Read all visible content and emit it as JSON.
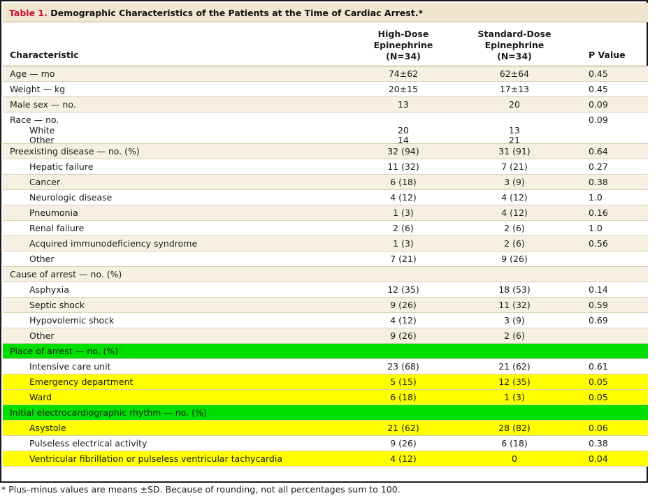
{
  "table": {
    "title_label": "Table 1.",
    "title_text": "Demographic Characteristics of the Patients at the Time of Cardiac Arrest.*",
    "columns": {
      "characteristic": "Characteristic",
      "high_line1": "High-Dose",
      "high_line2": "Epinephrine",
      "high_line3": "(N=34)",
      "std_line1": "Standard-Dose",
      "std_line2": "Epinephrine",
      "std_line3": "(N=34)",
      "p_value": "P Value"
    },
    "rows": [
      {
        "label": "Age — mo",
        "high": "74±62",
        "std": "62±64",
        "p": "0.45"
      },
      {
        "label": "Weight — kg",
        "high": "20±15",
        "std": "17±13",
        "p": "0.45"
      },
      {
        "label": "Male sex — no.",
        "high": "13",
        "std": "20",
        "p": "0.09"
      },
      {
        "label": "Race — no.",
        "high": "",
        "std": "",
        "p": "0.09",
        "sub": [
          {
            "label": "White",
            "high": "20",
            "std": "13"
          },
          {
            "label": "Other",
            "high": "14",
            "std": "21"
          }
        ]
      },
      {
        "label": "Preexisting disease — no. (%)",
        "high": "32 (94)",
        "std": "31 (91)",
        "p": "0.64"
      },
      {
        "label": "Hepatic failure",
        "high": "11 (32)",
        "std": "7 (21)",
        "p": "0.27"
      },
      {
        "label": "Cancer",
        "high": "6 (18)",
        "std": "3 (9)",
        "p": "0.38"
      },
      {
        "label": "Neurologic disease",
        "high": "4 (12)",
        "std": "4 (12)",
        "p": "1.0"
      },
      {
        "label": "Pneumonia",
        "high": "1 (3)",
        "std": "4 (12)",
        "p": "0.16"
      },
      {
        "label": "Renal failure",
        "high": "2 (6)",
        "std": "2 (6)",
        "p": "1.0"
      },
      {
        "label": "Acquired immunodeficiency syndrome",
        "high": "1 (3)",
        "std": "2 (6)",
        "p": "0.56"
      },
      {
        "label": "Other",
        "high": "7 (21)",
        "std": "9 (26)",
        "p": ""
      },
      {
        "label": "Cause of arrest — no. (%)",
        "high": "",
        "std": "",
        "p": ""
      },
      {
        "label": "Asphyxia",
        "high": "12 (35)",
        "std": "18 (53)",
        "p": "0.14"
      },
      {
        "label": "Septic shock",
        "high": "9 (26)",
        "std": "11 (32)",
        "p": "0.59"
      },
      {
        "label": "Hypovolemic shock",
        "high": "4 (12)",
        "std": "3 (9)",
        "p": "0.69"
      },
      {
        "label": "Other",
        "high": "9 (26)",
        "std": "2 (6)",
        "p": ""
      },
      {
        "label": "Place of arrest — no. (%)",
        "high": "",
        "std": "",
        "p": ""
      },
      {
        "label": "Intensive care unit",
        "high": "23 (68)",
        "std": "21 (62)",
        "p": "0.61"
      },
      {
        "label": "Emergency department",
        "high": "5 (15)",
        "std": "12 (35)",
        "p": "0.05"
      },
      {
        "label": "Ward",
        "high": "6 (18)",
        "std": "1 (3)",
        "p": "0.05"
      },
      {
        "label": "Initial electrocardiographic rhythm — no. (%)",
        "high": "",
        "std": "",
        "p": ""
      },
      {
        "label": "Asystole",
        "high": "21 (62)",
        "std": "28 (82)",
        "p": "0.06"
      },
      {
        "label": "Pulseless electrical activity",
        "high": "9 (26)",
        "std": "6 (18)",
        "p": "0.38"
      },
      {
        "label": "Ventricular fibrillation or pulseless ventricular tachycardia",
        "high": "4 (12)",
        "std": "0",
        "p": "0.04"
      }
    ],
    "footnote": "* Plus–minus values are means ±SD. Because of rounding, not all percentages sum to 100.",
    "colors": {
      "highlight_green": "#00e000",
      "highlight_yellow": "#ffff00",
      "title_label_red": "#c8102e",
      "title_bar_beige": "#f1e6d0",
      "row_beige": "#f6f0e2"
    }
  }
}
